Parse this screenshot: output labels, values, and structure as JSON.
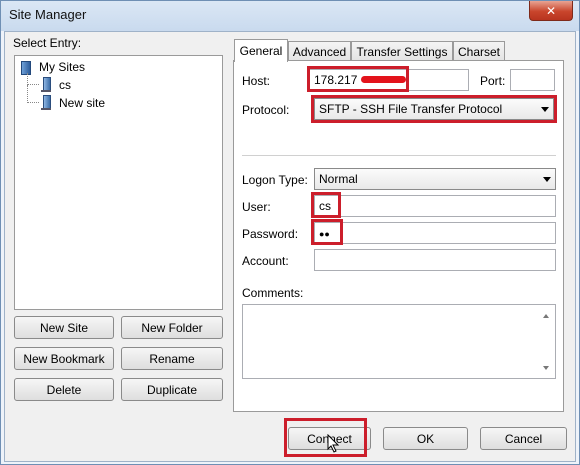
{
  "window": {
    "title": "Site Manager",
    "close_label": "✕"
  },
  "left": {
    "select_entry_label": "Select Entry:",
    "tree": [
      {
        "label": "My Sites",
        "icon": "folder-icon"
      },
      {
        "label": "cs",
        "icon": "server-icon"
      },
      {
        "label": "New site",
        "icon": "server-icon"
      }
    ],
    "buttons": {
      "new_site": "New Site",
      "new_folder": "New Folder",
      "new_bookmark": "New Bookmark",
      "rename": "Rename",
      "delete": "Delete",
      "duplicate": "Duplicate"
    }
  },
  "tabs": [
    "General",
    "Advanced",
    "Transfer Settings",
    "Charset"
  ],
  "general": {
    "host_label": "Host:",
    "host_value": "178.217",
    "port_label": "Port:",
    "port_value": "",
    "protocol_label": "Protocol:",
    "protocol_value": "SFTP - SSH File Transfer Protocol",
    "logon_type_label": "Logon Type:",
    "logon_type_value": "Normal",
    "user_label": "User:",
    "user_value": "cs",
    "password_label": "Password:",
    "password_value": "●●",
    "account_label": "Account:",
    "account_value": "",
    "comments_label": "Comments:",
    "comments_value": ""
  },
  "footer": {
    "connect": "Connect",
    "ok": "OK",
    "cancel": "Cancel"
  },
  "colors": {
    "highlight": "#cc1e2b",
    "redaction": "#e3131b"
  }
}
